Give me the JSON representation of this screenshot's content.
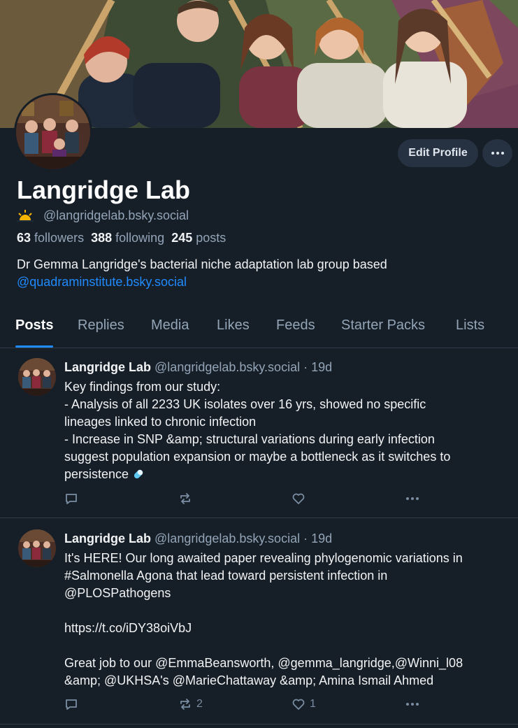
{
  "profile": {
    "display_name": "Langridge Lab",
    "handle": "@langridgelab.bsky.social",
    "stats": {
      "followers_count": "63",
      "followers_label": "followers",
      "following_count": "388",
      "following_label": "following",
      "posts_count": "245",
      "posts_label": "posts"
    },
    "bio_line1": "Dr Gemma Langridge's bacterial niche adaptation lab group based",
    "bio_link": "@quadraminstitute.bsky.social",
    "edit_button": "Edit Profile",
    "more_button": "•••"
  },
  "tabs": [
    {
      "label": "Posts",
      "active": true
    },
    {
      "label": "Replies"
    },
    {
      "label": "Media"
    },
    {
      "label": "Likes"
    },
    {
      "label": "Feeds"
    },
    {
      "label": "Starter Packs"
    },
    {
      "label": "Lists"
    }
  ],
  "posts": [
    {
      "author": "Langridge Lab",
      "handle": "@langridgelab.bsky.social",
      "time": "· 19d",
      "lines": [
        "Key findings from our study:",
        "- Analysis of all 2233 UK isolates over 16 yrs, showed no specific",
        "lineages linked to chronic infection",
        "- Increase in SNP &amp; structural variations during early infection",
        "suggest population expansion or maybe a bottleneck as it switches to",
        "persistence"
      ],
      "reply_count": "",
      "repost_count": "",
      "like_count": "",
      "more_label": "•••"
    },
    {
      "author": "Langridge Lab",
      "handle": "@langridgelab.bsky.social",
      "time": "· 19d",
      "lines": [
        "It's HERE! Our long awaited paper revealing phylogenomic variations in",
        "#Salmonella Agona that lead toward persistent infection in",
        "@PLOSPathogens",
        "",
        "https://t.co/iDY38oiVbJ",
        "",
        "Great job to our @EmmaBeansworth, @gemma_langridge,@Winni_l08",
        "&amp; @UKHSA's @MarieChattaway &amp; Amina Ismail Ahmed"
      ],
      "reply_count": "",
      "repost_count": "2",
      "like_count": "1",
      "more_label": "•••"
    }
  ],
  "colors": {
    "background": "#161e27",
    "accent": "#208bfe",
    "muted_text": "#93a5b7",
    "divider": "#2e3b4b"
  }
}
